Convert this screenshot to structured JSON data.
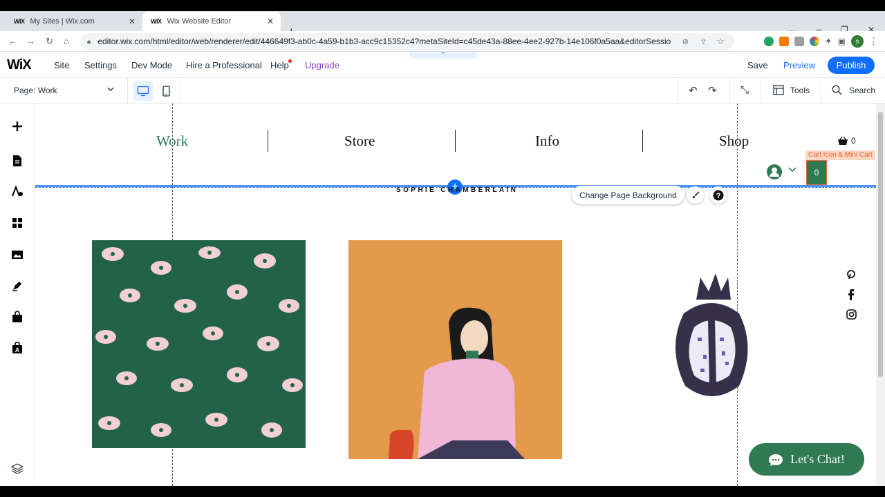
{
  "browser": {
    "tabs": [
      {
        "label": "My Sites | Wix.com",
        "favicon": "WIX"
      },
      {
        "label": "Wix Website Editor",
        "favicon": "WIX"
      }
    ],
    "url": "editor.wix.com/html/editor/web/renderer/edit/446649f3-ab0c-4a59-b1b3-acc9c15352c4?metaSiteId=c45de43a-88ee-4ee2-927b-14e106f0a5aa&editorSession...",
    "profile_initial": "s"
  },
  "wix_bar": {
    "logo": "WiX",
    "menu": [
      "Site",
      "Settings",
      "Dev Mode",
      "Hire a Professional",
      "Help",
      "Upgrade"
    ],
    "save": "Save",
    "preview": "Preview",
    "publish": "Publish"
  },
  "page_bar": {
    "page_label": "Page:",
    "page_value": "Work",
    "tools": "Tools",
    "search": "Search"
  },
  "site": {
    "nav": [
      "Work",
      "Store",
      "Info",
      "Shop"
    ],
    "active_nav": "Work",
    "cart_count": "0",
    "cart_label": "Cart Icon & Mini Cart",
    "cart_widget_count": "0",
    "site_name": "SOPHIE CHAMBERLAIN",
    "change_bg": "Change Page Background",
    "chat": "Let's Chat!",
    "social": [
      "pinterest-icon",
      "facebook-icon",
      "instagram-icon"
    ]
  },
  "colors": {
    "wix_blue": "#116dff",
    "site_green": "#2f7a53",
    "upgrade_purple": "#8a3cc8",
    "cart_orange": "#e8673a"
  }
}
